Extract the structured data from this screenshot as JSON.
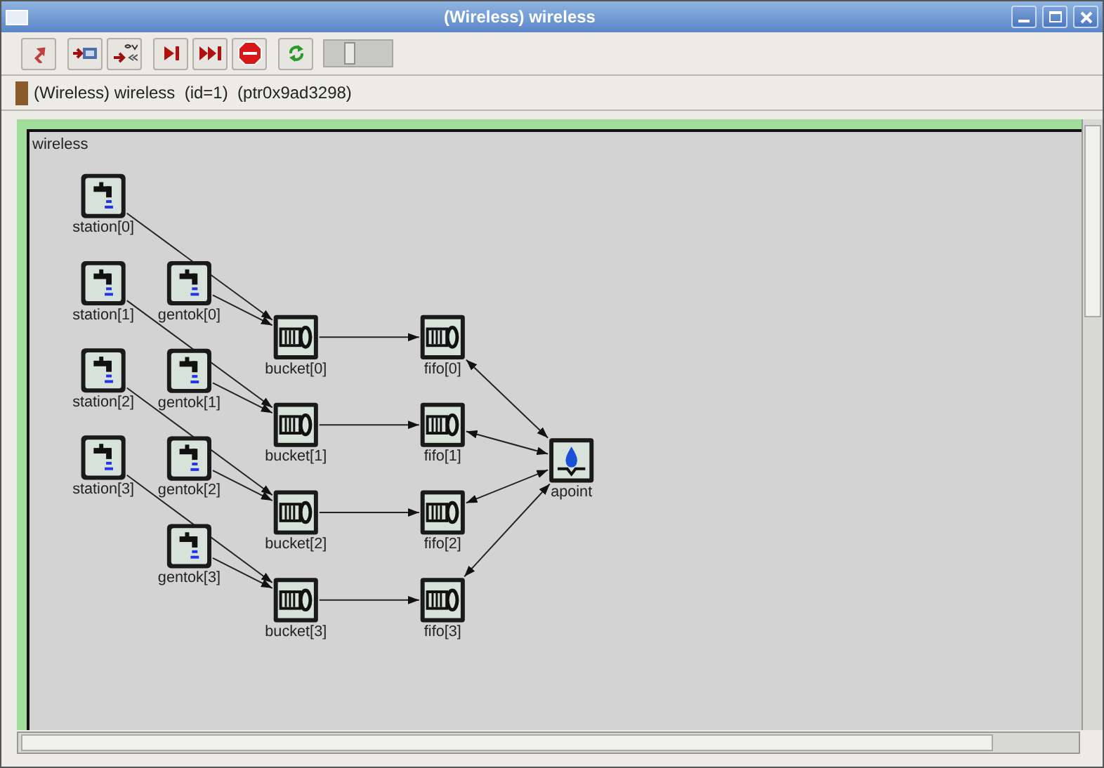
{
  "window": {
    "title": "(Wireless) wireless"
  },
  "toolbar": {
    "speed_slider": {
      "level": 0.35
    }
  },
  "info_bar": {
    "text": "(Wireless) wireless  (id=1)  (ptr0x9ad3298)"
  },
  "canvas": {
    "title": "wireless",
    "lanes": [
      {
        "station": {
          "label": "station[0]"
        },
        "gentok": {
          "label": "gentok[0]"
        },
        "bucket": {
          "label": "bucket[0]"
        },
        "fifo": {
          "label": "fifo[0]"
        }
      },
      {
        "station": {
          "label": "station[1]"
        },
        "gentok": {
          "label": "gentok[1]"
        },
        "bucket": {
          "label": "bucket[1]"
        },
        "fifo": {
          "label": "fifo[1]"
        }
      },
      {
        "station": {
          "label": "station[2]"
        },
        "gentok": {
          "label": "gentok[2]"
        },
        "bucket": {
          "label": "bucket[2]"
        },
        "fifo": {
          "label": "fifo[2]"
        }
      },
      {
        "station": {
          "label": "station[3]"
        },
        "gentok": {
          "label": "gentok[3]"
        },
        "bucket": {
          "label": "bucket[3]"
        },
        "fifo": {
          "label": "fifo[3]"
        }
      }
    ],
    "access_point": {
      "label": "apoint"
    }
  }
}
